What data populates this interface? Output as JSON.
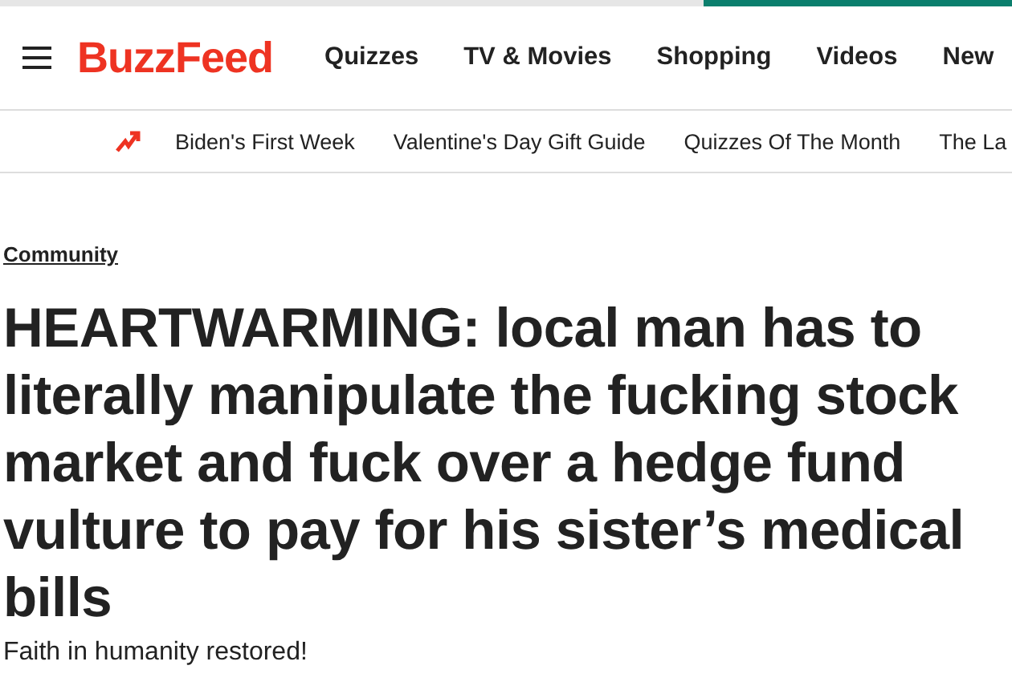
{
  "header": {
    "logo": "BuzzFeed",
    "nav": [
      "Quizzes",
      "TV & Movies",
      "Shopping",
      "Videos",
      "New"
    ]
  },
  "trending": {
    "items": [
      "Biden's First Week",
      "Valentine's Day Gift Guide",
      "Quizzes Of The Month",
      "The La"
    ]
  },
  "article": {
    "category": "Community",
    "headline": "HEARTWARMING: local man has to literally manipulate the fucking stock market and fuck over a hedge fund vulture to pay for his sister’s medical bills",
    "subtitle": "Faith in humanity restored!"
  }
}
